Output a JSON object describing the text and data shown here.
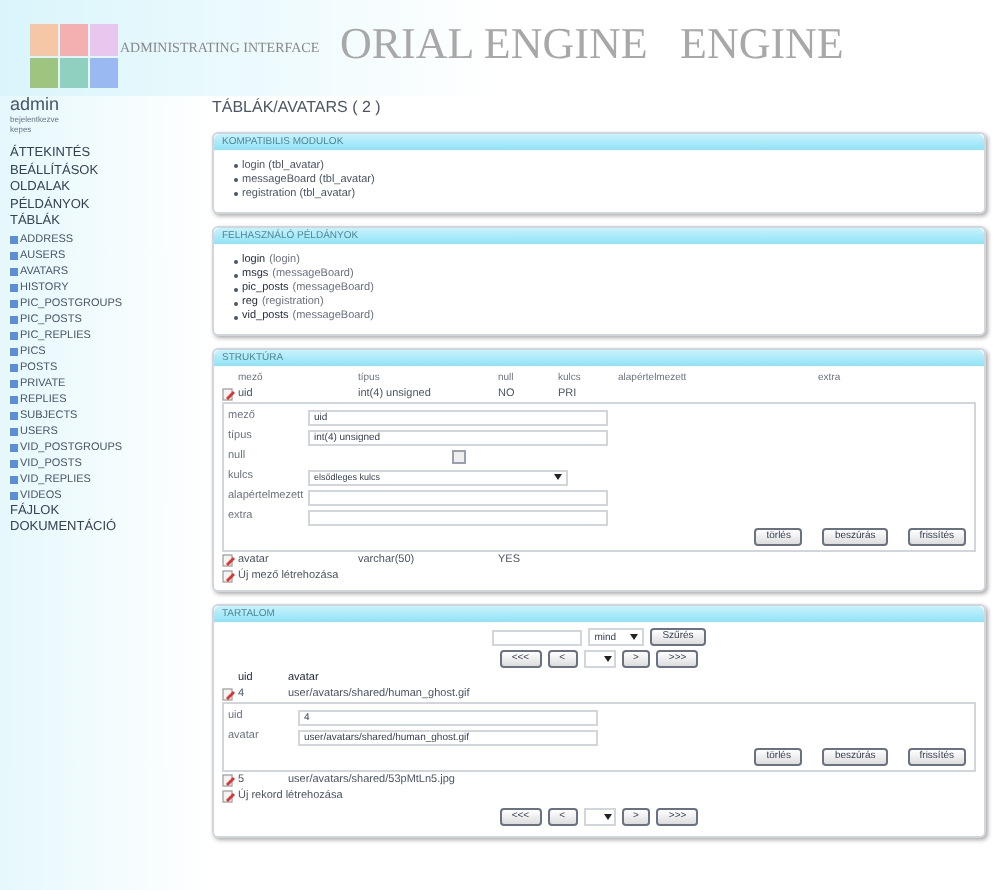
{
  "header": {
    "title": "ADMINISTRATING INTERFACE",
    "backdrop": [
      "ORIAL ENGINE",
      "ENGINE"
    ]
  },
  "user": {
    "name": "admin",
    "status": "bejelentkezve",
    "link": "kepes"
  },
  "nav": [
    {
      "label": "ÁTTEKINTÉS",
      "kind": "section"
    },
    {
      "label": "BEÁLLÍTÁSOK",
      "kind": "section"
    },
    {
      "label": "OLDALAK",
      "kind": "section"
    },
    {
      "label": "PÉLDÁNYOK",
      "kind": "section"
    },
    {
      "label": "TÁBLÁK",
      "kind": "section"
    },
    {
      "label": "ADDRESS",
      "kind": "table"
    },
    {
      "label": "AUSERS",
      "kind": "table"
    },
    {
      "label": "AVATARS",
      "kind": "table"
    },
    {
      "label": "HISTORY",
      "kind": "table"
    },
    {
      "label": "PIC_POSTGROUPS",
      "kind": "table"
    },
    {
      "label": "PIC_POSTS",
      "kind": "table"
    },
    {
      "label": "PIC_REPLIES",
      "kind": "table"
    },
    {
      "label": "PICS",
      "kind": "table"
    },
    {
      "label": "POSTS",
      "kind": "table"
    },
    {
      "label": "PRIVATE",
      "kind": "table"
    },
    {
      "label": "REPLIES",
      "kind": "table"
    },
    {
      "label": "SUBJECTS",
      "kind": "table"
    },
    {
      "label": "USERS",
      "kind": "table"
    },
    {
      "label": "VID_POSTGROUPS",
      "kind": "table"
    },
    {
      "label": "VID_POSTS",
      "kind": "table"
    },
    {
      "label": "VID_REPLIES",
      "kind": "table"
    },
    {
      "label": "VIDEOS",
      "kind": "table"
    },
    {
      "label": "FÁJLOK",
      "kind": "section"
    },
    {
      "label": "DOKUMENTÁCIÓ",
      "kind": "section"
    }
  ],
  "page_title": "TÁBLÁK/AVATARS ( 2 )",
  "modules": {
    "title": "KOMPATIBILIS MODULOK",
    "items": [
      "login (tbl_avatar)",
      "messageBoard (tbl_avatar)",
      "registration (tbl_avatar)"
    ]
  },
  "instances": {
    "title": "FELHASZNÁLÓ PÉLDÁNYOK",
    "items": [
      {
        "name": "login",
        "module": "(login)"
      },
      {
        "name": "msgs",
        "module": "(messageBoard)"
      },
      {
        "name": "pic_posts",
        "module": "(messageBoard)"
      },
      {
        "name": "reg",
        "module": "(registration)"
      },
      {
        "name": "vid_posts",
        "module": "(messageBoard)"
      }
    ]
  },
  "structure": {
    "title": "STRUKTÚRA",
    "columns": [
      "mező",
      "típus",
      "null",
      "kulcs",
      "alapértelmezett",
      "extra"
    ],
    "rows": [
      {
        "cells": [
          "uid",
          "int(4) unsigned",
          "NO",
          "PRI",
          "",
          ""
        ],
        "expanded": true
      },
      {
        "cells": [
          "avatar",
          "varchar(50)",
          "YES",
          "",
          "",
          ""
        ],
        "expanded": false
      }
    ],
    "form": {
      "fields": [
        {
          "label": "mező",
          "kind": "text",
          "value": "uid"
        },
        {
          "label": "típus",
          "kind": "text",
          "value": "int(4) unsigned"
        },
        {
          "label": "null",
          "kind": "checkbox",
          "checked": false
        },
        {
          "label": "kulcs",
          "kind": "select",
          "value": "elsődleges kulcs"
        },
        {
          "label": "alapértelmezett",
          "kind": "text"
        },
        {
          "label": "extra",
          "kind": "text"
        }
      ],
      "buttons": [
        "törlés",
        "beszúrás",
        "frissítés"
      ]
    },
    "new_link": "Új mező létrehozása"
  },
  "content": {
    "title": "TARTALOM",
    "filter_select": "mind",
    "filter_button": "Szűrés",
    "pager": [
      "<<<",
      "<",
      ">",
      ">>>"
    ],
    "columns": [
      "uid",
      "avatar"
    ],
    "rows": [
      {
        "cells": [
          "4",
          "user/avatars/shared/human_ghost.gif"
        ],
        "expanded": true
      },
      {
        "cells": [
          "5",
          "user/avatars/shared/53pMtLn5.jpg"
        ],
        "expanded": false
      }
    ],
    "form": {
      "fields": [
        {
          "label": "uid",
          "value": "4"
        },
        {
          "label": "avatar",
          "value": "user/avatars/shared/human_ghost.gif"
        }
      ],
      "buttons": [
        "törlés",
        "beszúrás",
        "frissítés"
      ]
    },
    "new_link": "Új rekord létrehozása"
  }
}
